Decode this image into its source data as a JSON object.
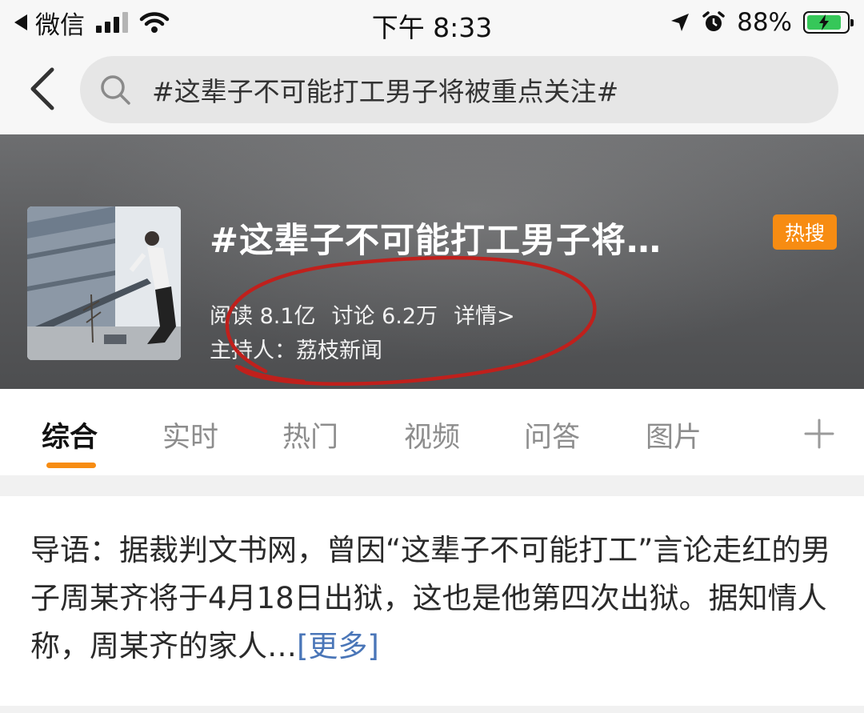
{
  "status_bar": {
    "back_app": "微信",
    "time": "下午 8:33",
    "battery": "88%",
    "battery_level": 0.88,
    "icons": [
      "signal-bars-icon",
      "wifi-icon",
      "location-arrow-icon",
      "alarm-clock-icon",
      "battery-charging-icon"
    ]
  },
  "search": {
    "query": "#这辈子不可能打工男子将被重点关注#"
  },
  "topic": {
    "title": "#这辈子不可能打工男子将…",
    "badge": "热搜",
    "reads": "阅读 8.1亿",
    "discussions": "讨论 6.2万",
    "detail": "详情>",
    "host": "主持人：荔枝新闻"
  },
  "tabs": [
    {
      "label": "综合",
      "active": true
    },
    {
      "label": "实时",
      "active": false
    },
    {
      "label": "热门",
      "active": false
    },
    {
      "label": "视频",
      "active": false
    },
    {
      "label": "问答",
      "active": false
    },
    {
      "label": "图片",
      "active": false
    }
  ],
  "intro": {
    "text": "导语：据裁判文书网，曾因“这辈子不可能打工”言论走红的男子周某齐将于4月18日出狱，这也是他第四次出狱。据知情人称，周某齐的家人…",
    "more": "[更多]"
  },
  "colors": {
    "accent": "#f78c12",
    "link": "#4a76b8",
    "annotation": "#c0201c",
    "battery": "#36c759"
  }
}
